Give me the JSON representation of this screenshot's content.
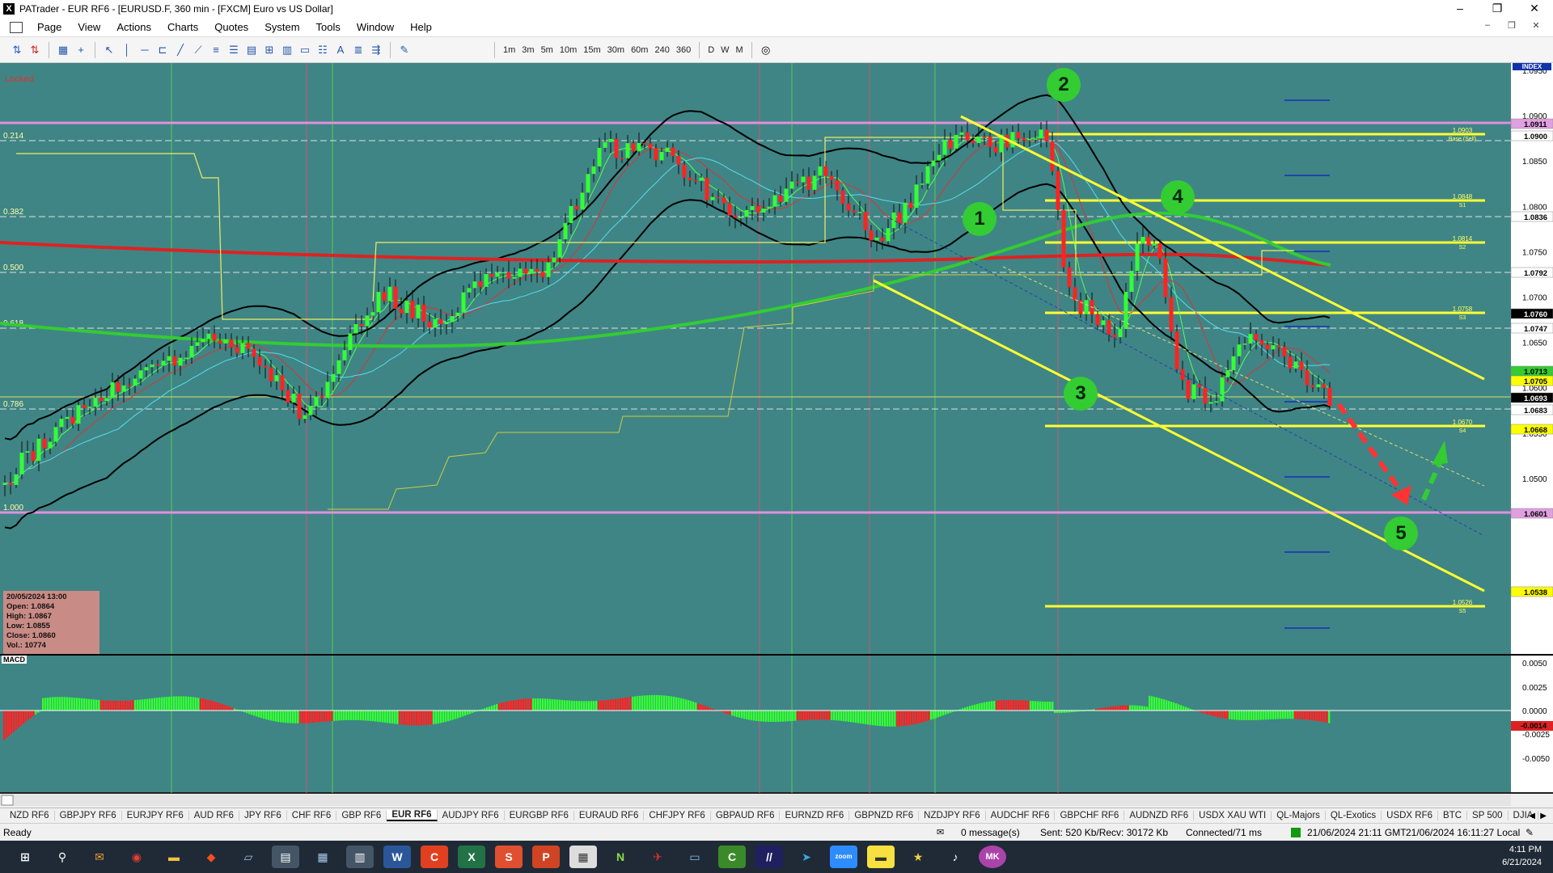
{
  "window": {
    "title": "PATrader - EUR RF6 - [EURUSD.F, 360 min - [FXCM] Euro vs US Dollar]",
    "app_icon": "X"
  },
  "menu": {
    "items": [
      "Page",
      "View",
      "Actions",
      "Charts",
      "Quotes",
      "System",
      "Tools",
      "Window",
      "Help"
    ]
  },
  "toolbar": {
    "timeframes": [
      "1m",
      "3m",
      "5m",
      "10m",
      "15m",
      "30m",
      "60m",
      "240",
      "360",
      "D",
      "W",
      "M"
    ]
  },
  "chart": {
    "locked_label": "Locked",
    "index_label": "INDEX",
    "fib_labels": [
      "0.214",
      "0.382",
      "0.500",
      "0.618",
      "0.786",
      "1.000"
    ],
    "price_axis": [
      "1.0950",
      "1.0900",
      "1.0850",
      "1.0800",
      "1.0750",
      "1.0700",
      "1.0650",
      "1.0600",
      "1.0550",
      "1.0500"
    ],
    "price_tags": [
      {
        "value": "1.0911",
        "bg": "#e0a0e0",
        "fg": "#000"
      },
      {
        "value": "1.0900",
        "bg": "#ffffff",
        "fg": "#000"
      },
      {
        "value": "1.0836",
        "bg": "#ffffff",
        "fg": "#000"
      },
      {
        "value": "1.0792",
        "bg": "#ffffff",
        "fg": "#000"
      },
      {
        "value": "1.0760",
        "bg": "#000000",
        "fg": "#fff"
      },
      {
        "value": "1.0747",
        "bg": "#ffffff",
        "fg": "#000"
      },
      {
        "value": "1.0713",
        "bg": "#33cc33",
        "fg": "#000"
      },
      {
        "value": "1.0705",
        "bg": "#ffff00",
        "fg": "#000"
      },
      {
        "value": "1.0693",
        "bg": "#000000",
        "fg": "#fff"
      },
      {
        "value": "1.0683",
        "bg": "#ffffff",
        "fg": "#000"
      },
      {
        "value": "1.0668",
        "bg": "#ffff00",
        "fg": "#000"
      },
      {
        "value": "1.0601",
        "bg": "#e0a0e0",
        "fg": "#000"
      },
      {
        "value": "1.0538",
        "bg": "#ffff00",
        "fg": "#000"
      }
    ],
    "pivot_labels": [
      {
        "price": "1.0903",
        "name": "Base (Sell)"
      },
      {
        "price": "1.0848",
        "name": "S1"
      },
      {
        "price": "1.0814",
        "name": "S2"
      },
      {
        "price": "1.0758",
        "name": "S3"
      },
      {
        "price": "1.0670",
        "name": "S4"
      },
      {
        "price": "1.0526",
        "name": "S5"
      }
    ],
    "wave_markers": [
      "1",
      "2",
      "3",
      "4",
      "5"
    ],
    "ohlc_box": {
      "date": "20/05/2024 13:00",
      "open": "Open: 1.0864",
      "high": "High: 1.0867",
      "low": "Low: 1.0855",
      "close": "Close: 1.0860",
      "vol": "Vol.: 10774"
    },
    "macd": {
      "label": "MACD",
      "axis": [
        "0.0050",
        "0.0025",
        "0.0000",
        "-0.0025",
        "-0.0050"
      ],
      "current_tag": "-0.0014"
    },
    "colors": {
      "background": "#3f8585",
      "grid": "#4d9494",
      "bull": "#33ff33",
      "bear": "#ff2222",
      "fib_line": "#e0e0e0",
      "magenta": "#e090e0",
      "yellow": "#ffff33"
    }
  },
  "symbol_tabs": [
    "NZD RF6",
    "GBPJPY RF6",
    "EURJPY RF6",
    "AUD RF6",
    "JPY RF6",
    "CHF RF6",
    "GBP RF6",
    "EUR RF6",
    "AUDJPY RF6",
    "EURGBP RF6",
    "EURAUD RF6",
    "CHFJPY RF6",
    "GBPAUD RF6",
    "EURNZD RF6",
    "GBPNZD RF6",
    "NZDJPY RF6",
    "AUDCHF RF6",
    "GBPCHF RF6",
    "AUDNZD RF6",
    "USDX XAU WTI",
    "QL-Majors",
    "QL-Exotics",
    "USDX RF6",
    "BTC",
    "SP 500",
    "DJIA"
  ],
  "active_tab": "EUR RF6",
  "status": {
    "ready": "Ready",
    "messages": "0 message(s)",
    "traffic": "Sent: 520 Kb/Recv: 30172 Kb",
    "connection": "Connected/71 ms",
    "server_time": "21/06/2024 21:11 GMT",
    "local_time": "21/06/2024 16:11:27 Local"
  },
  "taskbar": {
    "time": "4:11 PM",
    "date": "6/21/2024"
  }
}
